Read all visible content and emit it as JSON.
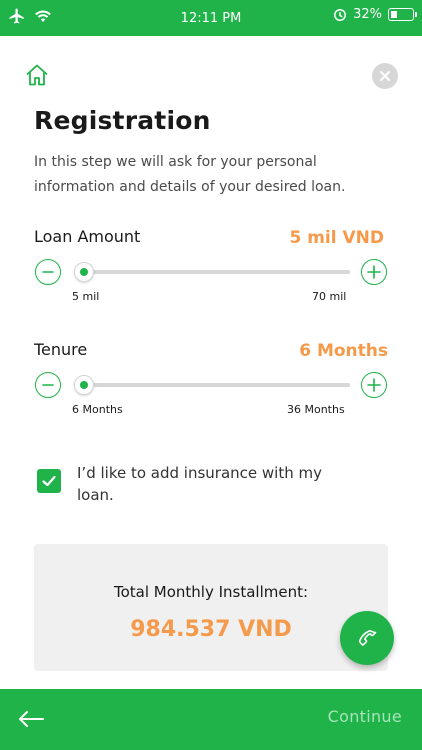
{
  "status": {
    "time": "12:11 PM",
    "battery": "32%",
    "battery_fraction": 0.32
  },
  "header": {
    "title": "Registration",
    "description": "In this step we will ask for your personal information and details of your desired loan."
  },
  "loan": {
    "label": "Loan Amount",
    "value": "5 mil VND",
    "min_label": "5 mil",
    "max_label": "70 mil",
    "slider_fraction": 0.0
  },
  "tenure": {
    "label": "Tenure",
    "value": "6 Months",
    "min_label": "6 Months",
    "max_label": "36 Months",
    "slider_fraction": 0.0
  },
  "insurance": {
    "checked": true,
    "label": "I’d like to add insurance with my loan."
  },
  "summary": {
    "label": "Total Monthly Installment:",
    "value": "984.537 VND"
  },
  "footer": {
    "continue_label": "Continue"
  },
  "colors": {
    "brand": "#1fb34a",
    "accent": "#f59a4a",
    "card": "#f0f0f0"
  },
  "icons": [
    "airplane-icon",
    "wifi-icon",
    "location-icon",
    "home-icon",
    "close-icon",
    "minus-icon",
    "plus-icon",
    "check-icon",
    "phone-icon",
    "arrow-left-icon"
  ]
}
